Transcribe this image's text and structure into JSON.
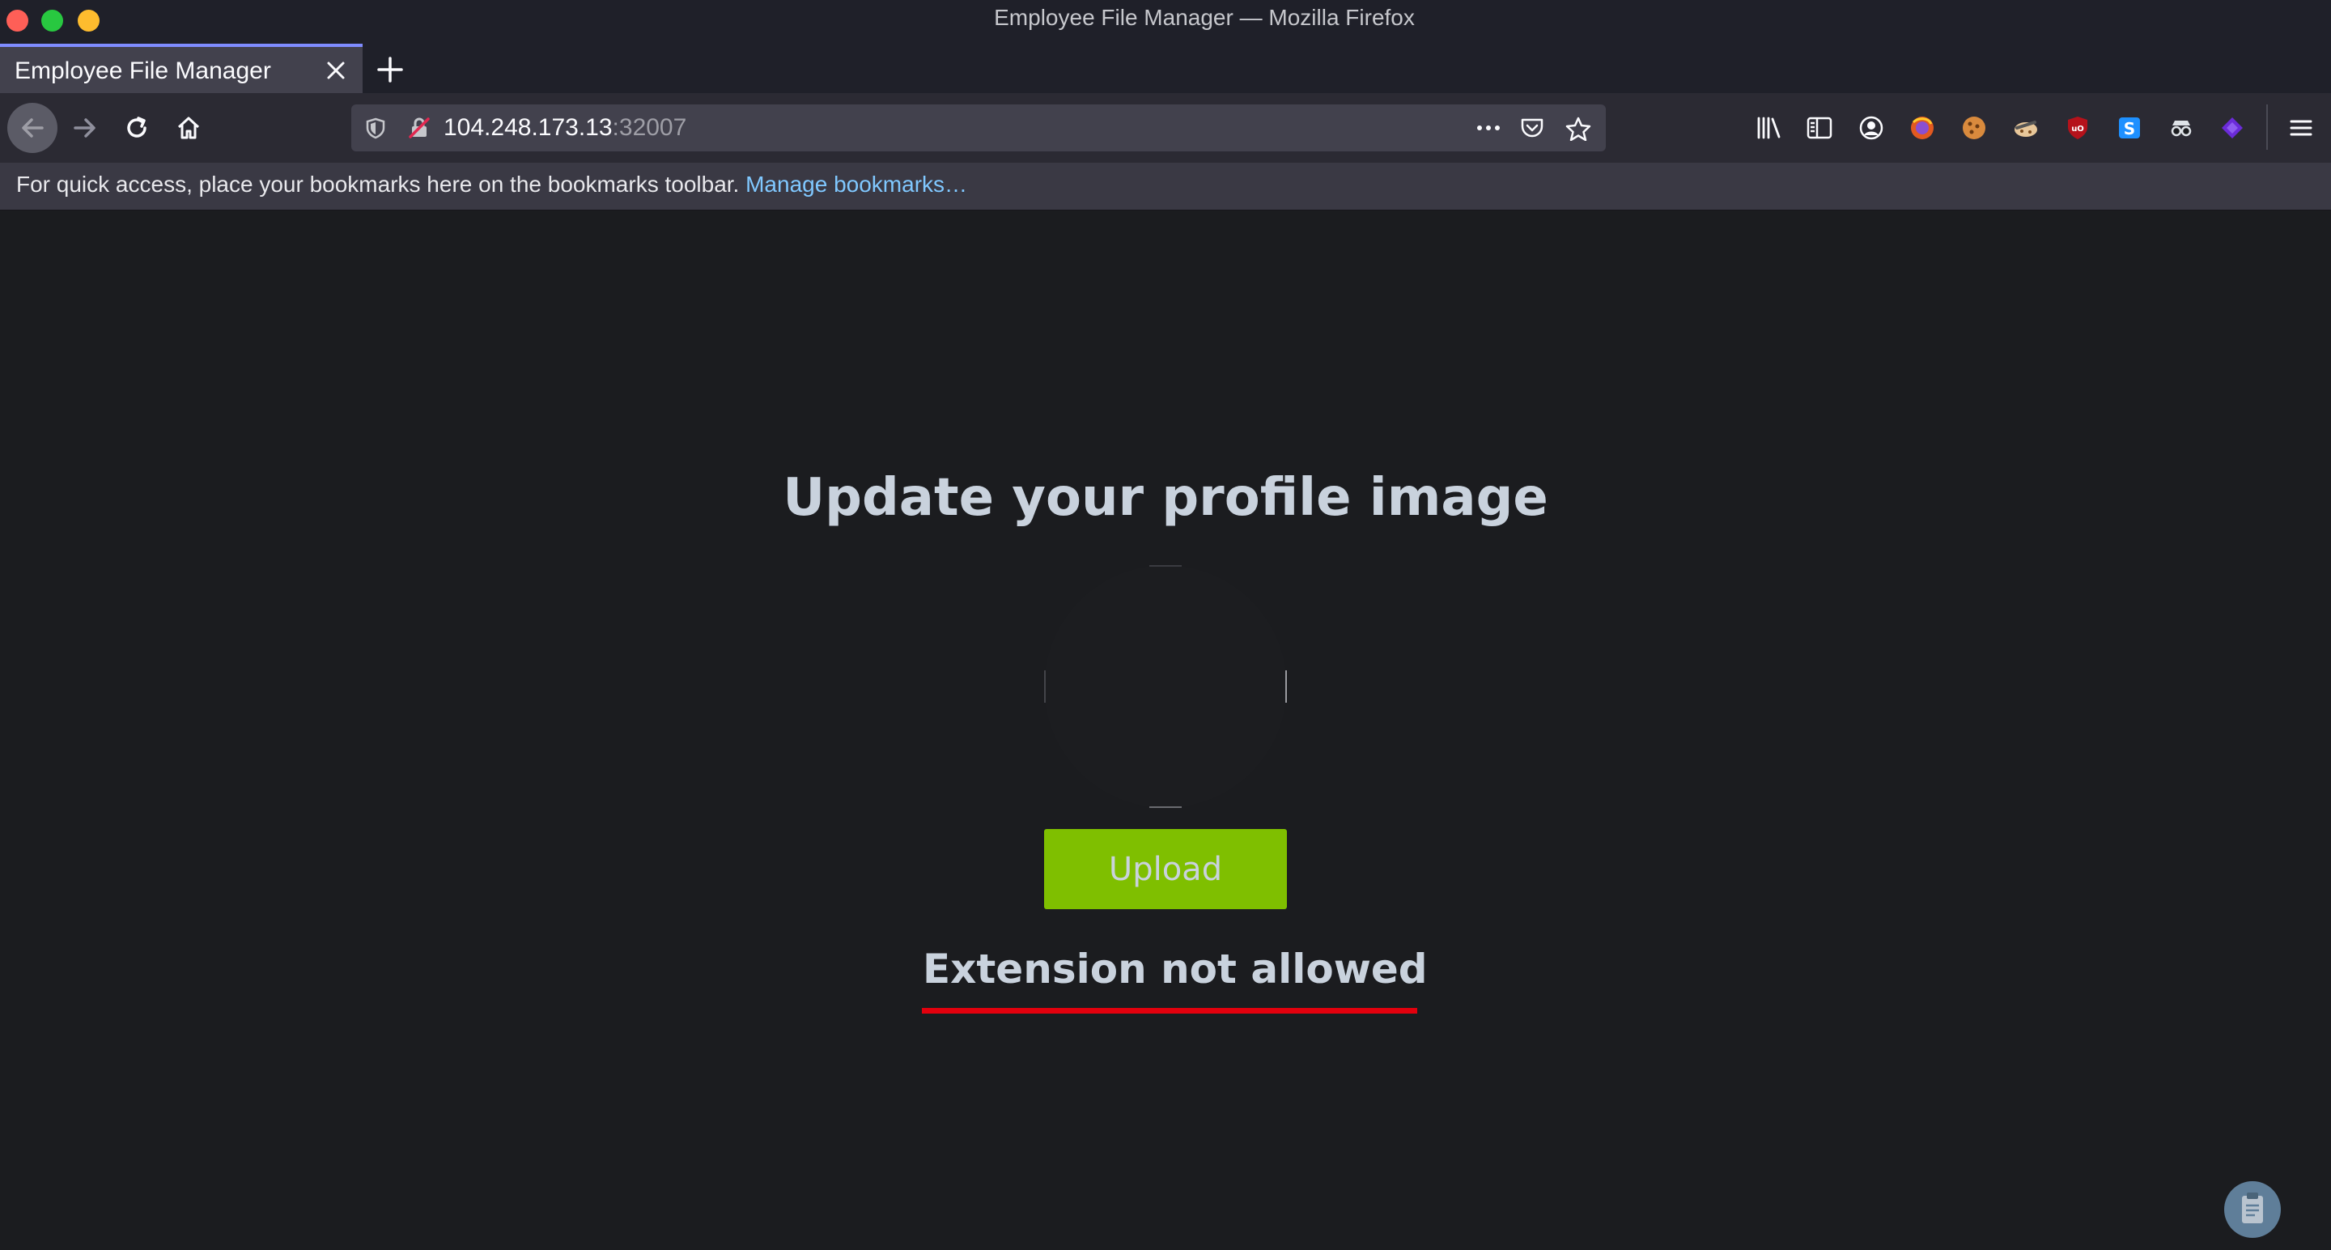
{
  "window": {
    "title": "Employee File Manager — Mozilla Firefox",
    "controls": [
      "close",
      "minimize",
      "maximize"
    ]
  },
  "tabs": [
    {
      "label": "Employee File Manager",
      "active": true
    }
  ],
  "navbar": {
    "url_host": "104.248.173.13",
    "url_port": ":32007",
    "extensions": [
      "library-icon",
      "sidebar-icon",
      "account-icon",
      "firefox-relay-icon",
      "cookie-icon",
      "cookie-editor-icon",
      "ublock-origin-icon",
      "s-extension-icon",
      "spy-extension-icon",
      "wappalyzer-icon",
      "menu-icon"
    ]
  },
  "bookmarks_bar": {
    "message": "For quick access, place your bookmarks here on the bookmarks toolbar.",
    "link": "Manage bookmarks…"
  },
  "main": {
    "heading": "Update your profile image",
    "upload_label": "Upload",
    "error": "Extension not allowed"
  },
  "colors": {
    "accent_green": "#7fbf00",
    "error_underline": "#e3000d",
    "page_background": "#1b1c1f",
    "text": "#c9d2dd"
  }
}
